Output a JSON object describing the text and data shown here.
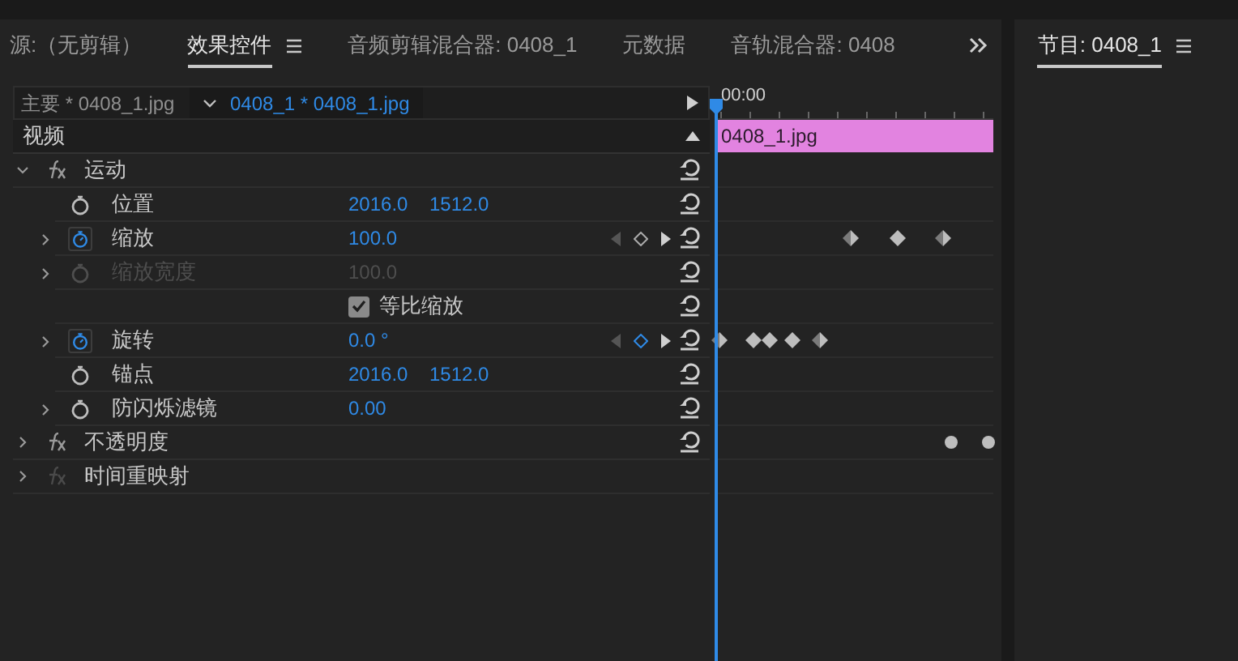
{
  "tabs": [
    {
      "label": "源:（无剪辑）",
      "selected": false,
      "menu": false
    },
    {
      "label": "效果控件",
      "selected": true,
      "menu": true
    },
    {
      "label": "音频剪辑混合器: 0408_1",
      "selected": false,
      "menu": false
    },
    {
      "label": "元数据",
      "selected": false,
      "menu": false
    },
    {
      "label": "音轨混合器: 0408",
      "selected": false,
      "menu": false
    }
  ],
  "program_tab": {
    "label": "节目: 0408_1",
    "selected": true,
    "menu": true
  },
  "header": {
    "master": "主要 * 0408_1.jpg",
    "clip": "0408_1 * 0408_1.jpg",
    "timecode": "00:00",
    "clip_bar": "0408_1.jpg"
  },
  "rows": [
    {
      "kind": "section",
      "label": "视频",
      "expanded": true
    },
    {
      "kind": "effect",
      "label": "运动",
      "expanded": true,
      "disabled": false,
      "reset": true
    },
    {
      "kind": "property",
      "label": "位置",
      "expandable": false,
      "animated": false,
      "disabled": false,
      "values": [
        "2016.0",
        "1512.0"
      ],
      "nav": false,
      "reset": true,
      "keyframes": []
    },
    {
      "kind": "property",
      "label": "缩放",
      "expandable": true,
      "animated": true,
      "disabled": false,
      "values": [
        "100.0"
      ],
      "nav": true,
      "reset": true,
      "keyframes": [
        {
          "kind": "half",
          "level": 0.49
        },
        {
          "kind": "full",
          "level": 0.655
        },
        {
          "kind": "half",
          "level": 0.82
        }
      ]
    },
    {
      "kind": "property",
      "label": "缩放宽度",
      "expandable": true,
      "animated": false,
      "disabled": true,
      "values": [
        "100.0"
      ],
      "nav": false,
      "reset": true,
      "keyframes": []
    },
    {
      "kind": "checkbox",
      "label": "等比缩放",
      "checked": true,
      "reset": true
    },
    {
      "kind": "property",
      "label": "旋转",
      "expandable": true,
      "animated": true,
      "disabled": false,
      "values": [
        "0.0 °"
      ],
      "nav": true,
      "reset": true,
      "keyframes": [
        {
          "kind": "half",
          "level": 0.015
        },
        {
          "kind": "full",
          "level": 0.14
        },
        {
          "kind": "full",
          "level": 0.2
        },
        {
          "kind": "full",
          "level": 0.28
        },
        {
          "kind": "half",
          "level": 0.38
        }
      ]
    },
    {
      "kind": "property",
      "label": "锚点",
      "expandable": false,
      "animated": false,
      "disabled": false,
      "values": [
        "2016.0",
        "1512.0"
      ],
      "nav": false,
      "reset": true,
      "keyframes": []
    },
    {
      "kind": "property",
      "label": "防闪烁滤镜",
      "expandable": true,
      "animated": false,
      "disabled": false,
      "values": [
        "0.00"
      ],
      "nav": false,
      "reset": true,
      "keyframes": []
    },
    {
      "kind": "effect",
      "label": "不透明度",
      "expanded": false,
      "disabled": false,
      "reset": true,
      "keyframes": [
        {
          "kind": "dot",
          "level": 0.85
        },
        {
          "kind": "dot",
          "level": 0.985
        }
      ]
    },
    {
      "kind": "effect",
      "label": "时间重映射",
      "expanded": false,
      "disabled": true,
      "reset": false
    }
  ]
}
